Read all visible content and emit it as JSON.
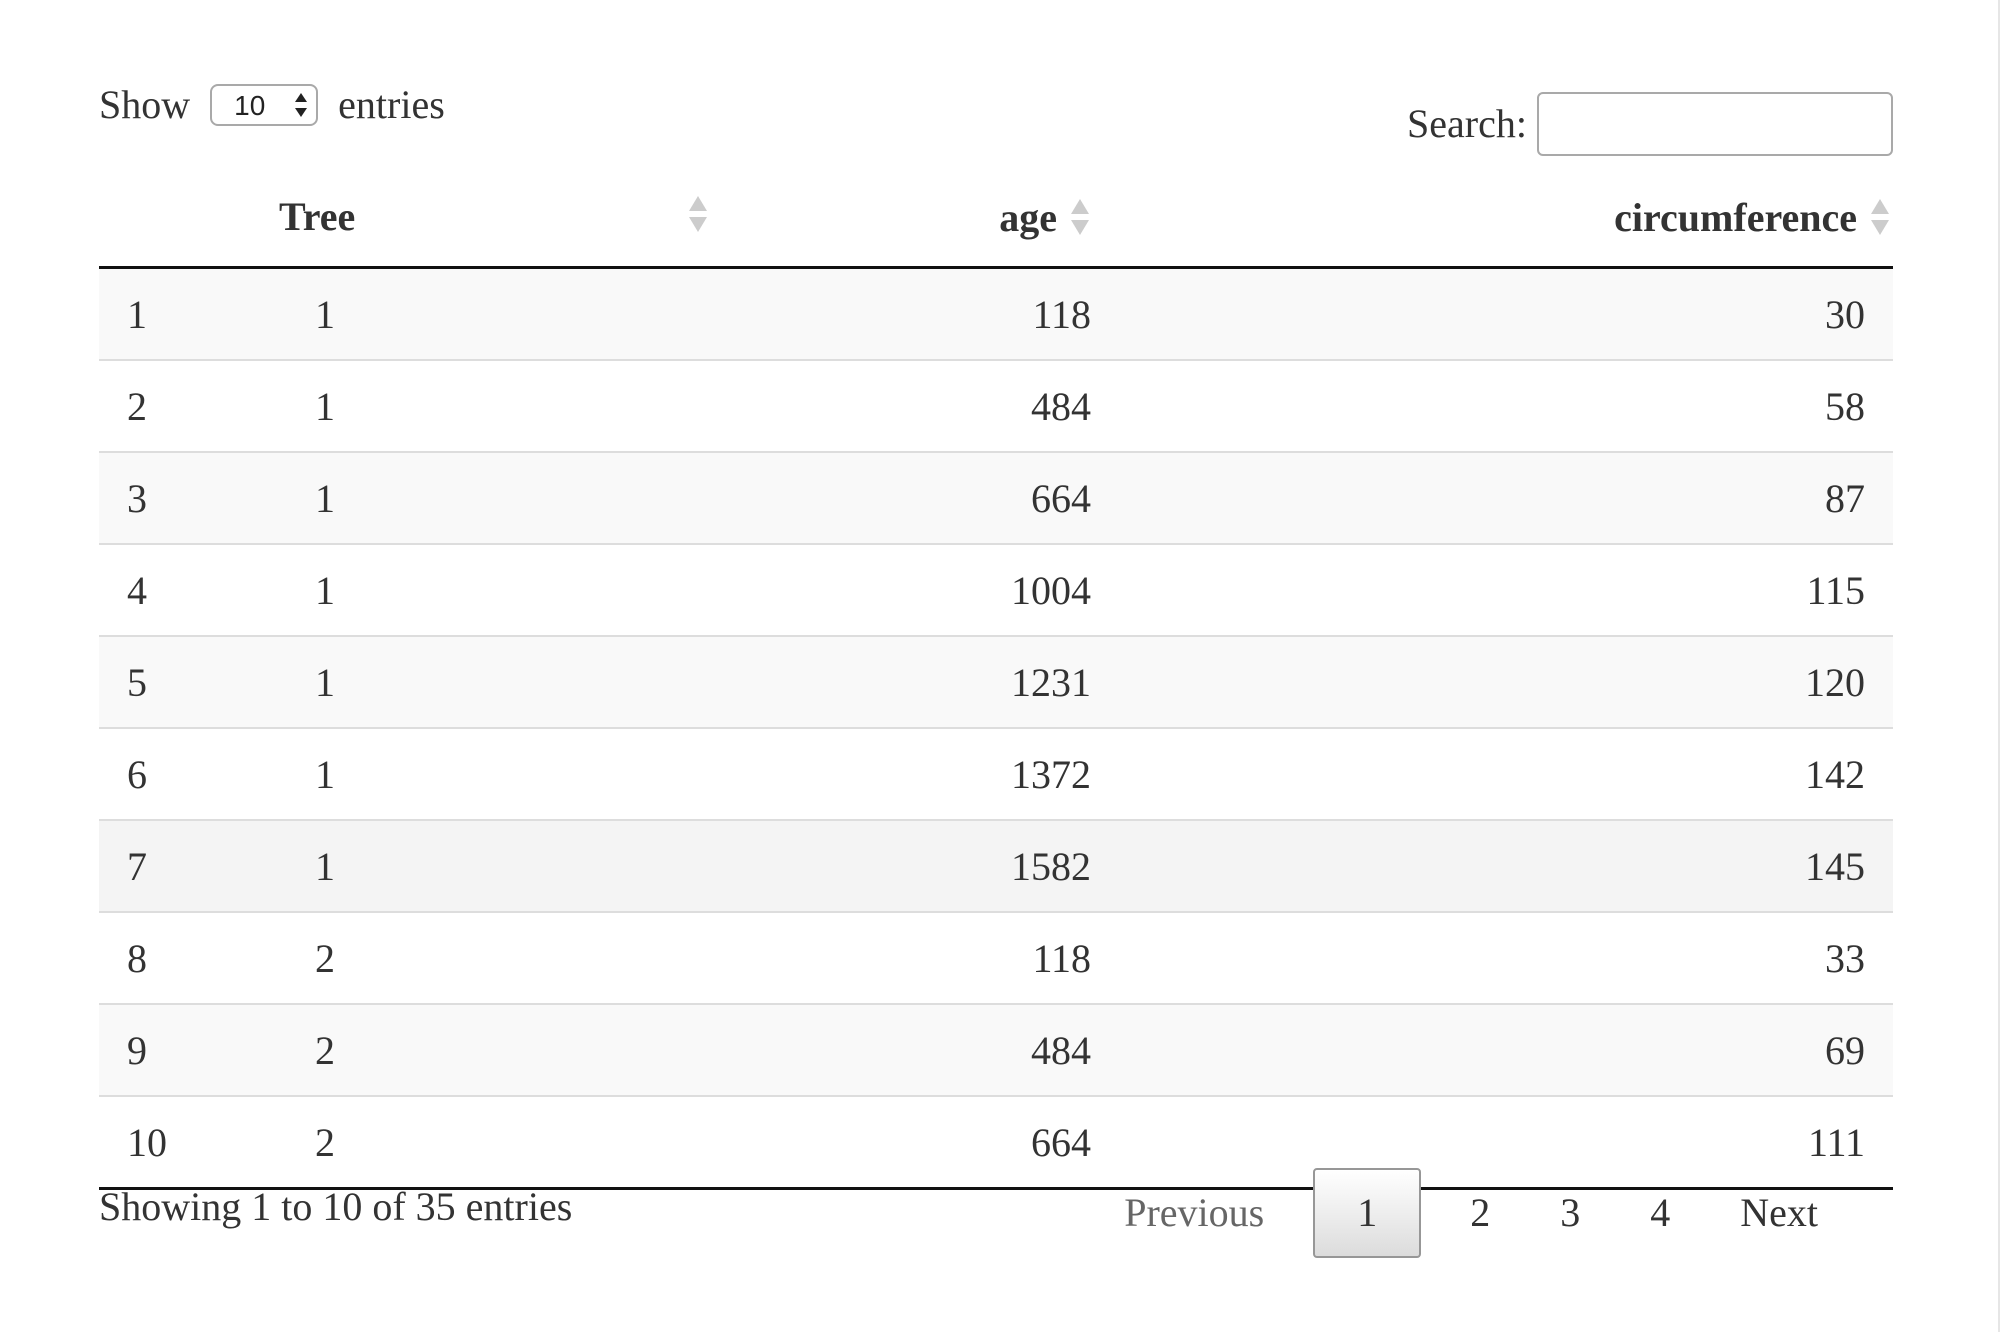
{
  "length_control": {
    "prefix": "Show",
    "value": "10",
    "suffix": "entries"
  },
  "search": {
    "label": "Search:",
    "value": "",
    "placeholder": ""
  },
  "table": {
    "columns": [
      "",
      "Tree",
      "age",
      "circumference"
    ],
    "rows": [
      {
        "idx": "1",
        "tree": "1",
        "age": "118",
        "circumference": "30"
      },
      {
        "idx": "2",
        "tree": "1",
        "age": "484",
        "circumference": "58"
      },
      {
        "idx": "3",
        "tree": "1",
        "age": "664",
        "circumference": "87"
      },
      {
        "idx": "4",
        "tree": "1",
        "age": "1004",
        "circumference": "115"
      },
      {
        "idx": "5",
        "tree": "1",
        "age": "1231",
        "circumference": "120"
      },
      {
        "idx": "6",
        "tree": "1",
        "age": "1372",
        "circumference": "142"
      },
      {
        "idx": "7",
        "tree": "1",
        "age": "1582",
        "circumference": "145"
      },
      {
        "idx": "8",
        "tree": "2",
        "age": "118",
        "circumference": "33"
      },
      {
        "idx": "9",
        "tree": "2",
        "age": "484",
        "circumference": "69"
      },
      {
        "idx": "10",
        "tree": "2",
        "age": "664",
        "circumference": "111"
      }
    ]
  },
  "footer": {
    "info": "Showing 1 to 10 of 35 entries",
    "pagination": {
      "previous": "Previous",
      "pages": [
        "1",
        "2",
        "3",
        "4"
      ],
      "current": "1",
      "next": "Next"
    }
  },
  "colors": {
    "text": "#333333",
    "odd_row": "#f9f9f9",
    "border": "#dddddd",
    "header_rule": "#111111",
    "sort_icon": "#cccccc"
  },
  "icons": {
    "sort": "sort-both-icon",
    "select_arrows": "select-updown-icon"
  }
}
